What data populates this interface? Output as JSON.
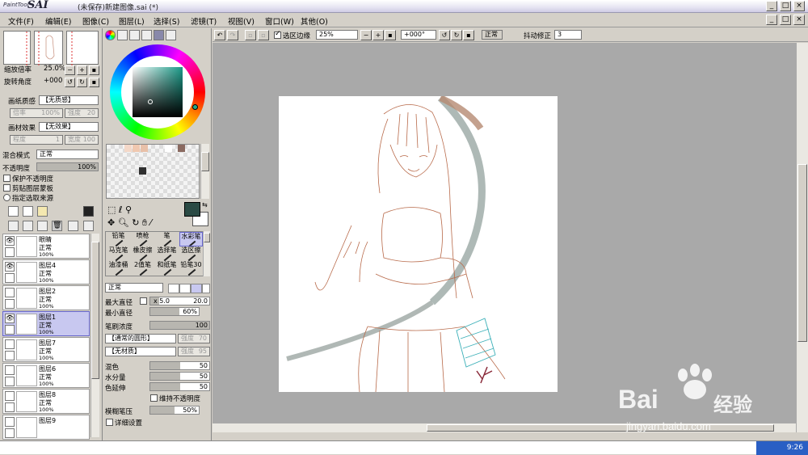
{
  "title": {
    "app_logo": "PaintTool",
    "app_name": "SAI",
    "window_title": "(未保存)新建图像.sai (*)"
  },
  "menu": [
    "文件(F)",
    "编辑(E)",
    "图像(C)",
    "图层(L)",
    "选择(S)",
    "滤镜(T)",
    "视图(V)",
    "窗口(W)",
    "其他(O)"
  ],
  "navigator": {
    "zoom_label": "缩放倍率",
    "zoom_value": "25.0%",
    "angle_label": "旋转角度",
    "angle_value": "+000"
  },
  "paper_texture": {
    "label": "画纸质感",
    "value": "【无质感】",
    "ratio_label": "倍率",
    "ratio_value": "100%",
    "strength_label": "强度",
    "strength_value": "20"
  },
  "paper_effect": {
    "label": "画材效果",
    "value": "【无效果】",
    "degree_label": "程度",
    "degree_value": "1",
    "width_label": "宽度",
    "width_value": "100"
  },
  "layer_props": {
    "blend_label": "混合模式",
    "blend_value": "正常",
    "opacity_label": "不透明度",
    "opacity_value": "100%",
    "opacity_level": 1.0,
    "protect_opacity": "保护不透明度",
    "clipping": "剪贴图层蒙板",
    "selection_source": "指定选取来源"
  },
  "layers": [
    {
      "name": "眼睛",
      "mode": "正常",
      "opacity": "100%",
      "visible": true,
      "selected": false
    },
    {
      "name": "图层4",
      "mode": "正常",
      "opacity": "100%",
      "visible": true,
      "selected": false
    },
    {
      "name": "图层2",
      "mode": "正常",
      "opacity": "100%",
      "visible": false,
      "selected": false
    },
    {
      "name": "图层1",
      "mode": "正常",
      "opacity": "100%",
      "visible": true,
      "selected": true
    },
    {
      "name": "图层7",
      "mode": "正常",
      "opacity": "100%",
      "visible": false,
      "selected": false
    },
    {
      "name": "图层6",
      "mode": "正常",
      "opacity": "100%",
      "visible": false,
      "selected": false
    },
    {
      "name": "图层8",
      "mode": "正常",
      "opacity": "100%",
      "visible": false,
      "selected": false
    },
    {
      "name": "图层9",
      "mode": "",
      "opacity": "",
      "visible": false,
      "selected": false
    }
  ],
  "colors": {
    "foreground": "#2a4a44",
    "background": "#ffffff",
    "swatches": [
      "#f4d8c8",
      "#f0c8b0",
      "#e8c0a8",
      "#ffffff",
      "#8a6a60",
      "#303030"
    ]
  },
  "tools": [
    {
      "label": "铅笔",
      "selected": false
    },
    {
      "label": "喷枪",
      "selected": false
    },
    {
      "label": "笔",
      "selected": false
    },
    {
      "label": "水彩笔",
      "selected": true
    },
    {
      "label": "马克笔",
      "selected": false
    },
    {
      "label": "橡皮擦",
      "selected": false
    },
    {
      "label": "选择笔",
      "selected": false
    },
    {
      "label": "选区擦",
      "selected": false
    },
    {
      "label": "油漆桶",
      "selected": false
    },
    {
      "label": "2值笔",
      "selected": false
    },
    {
      "label": "和纸笔",
      "selected": false
    },
    {
      "label": "铅笔30",
      "selected": false
    }
  ],
  "brush": {
    "mode": "正常",
    "max_size_label": "最大直径",
    "max_size_mult": "x 5.0",
    "max_size_value": "20.0",
    "max_size_level": 0.15,
    "min_size_label": "最小直径",
    "min_size_value": "60%",
    "min_size_level": 0.6,
    "density_label": "笔刷浓度",
    "density_value": "100",
    "density_level": 1.0,
    "shape_value": "【通常的圆形】",
    "shape_strength": "强度",
    "shape_strength_value": "70",
    "texture_value": "【无材质】",
    "texture_strength": "强度",
    "texture_strength_value": "95",
    "blend_label": "混色",
    "blend_value": "50",
    "blend_level": 0.5,
    "water_label": "水分量",
    "water_value": "50",
    "water_level": 0.5,
    "stretch_label": "色延伸",
    "stretch_value": "50",
    "stretch_level": 0.5,
    "keep_opacity": "维持不透明度",
    "blur_label": "模糊笔压",
    "blur_value": "50%",
    "blur_level": 0.5,
    "detail_label": "详细设置"
  },
  "toolbar": {
    "sel_edge": "选区边缘",
    "zoom": "25%",
    "angle": "+000°",
    "mode": "正常",
    "stab_label": "抖动修正",
    "stab_value": "3"
  },
  "taskbar": {
    "time": "9:26"
  },
  "watermark": {
    "brand": "Bai",
    "brand2": "经验",
    "url": "jingyan.baidu.com"
  }
}
